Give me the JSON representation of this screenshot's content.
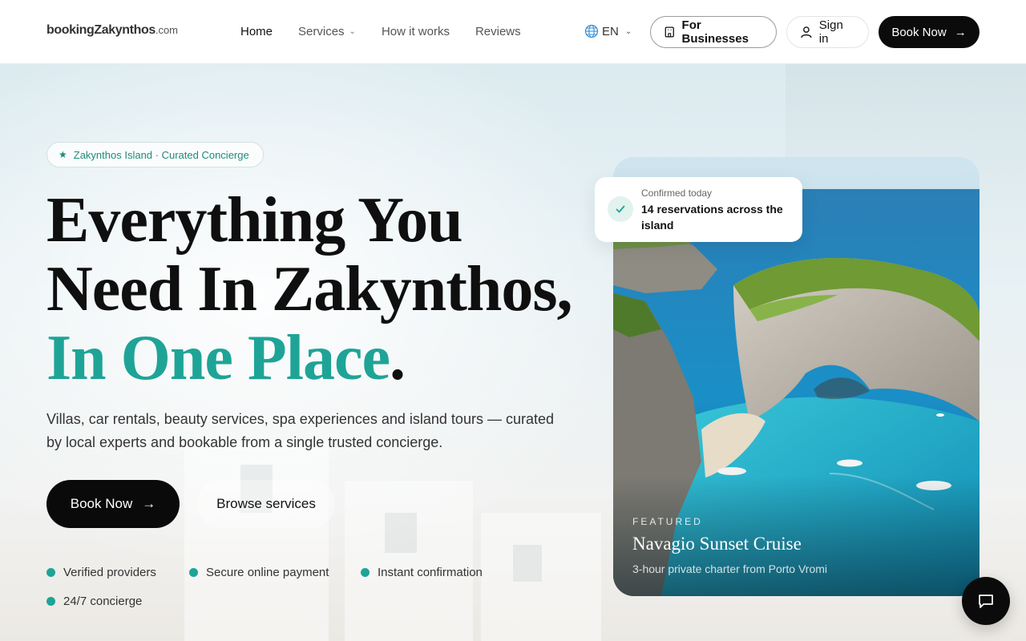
{
  "brand": {
    "name": "bookingZakynthos",
    "tld": ".com"
  },
  "nav": {
    "items": [
      {
        "label": "Home",
        "active": true
      },
      {
        "label": "Services",
        "has_dropdown": true
      },
      {
        "label": "How it works"
      },
      {
        "label": "Reviews"
      }
    ]
  },
  "header": {
    "language": "EN",
    "businesses_label": "For Businesses",
    "signin_label": "Sign in",
    "book_label": "Book Now"
  },
  "hero": {
    "badge": "Zakynthos Island · Curated Concierge",
    "headline_part1": "Everything You Need In Zakynthos,",
    "headline_accent": "In One Place",
    "headline_end": ".",
    "subtext": "Villas, car rentals, beauty services, spa experiences and island tours — curated by local experts and bookable from a single trusted concierge.",
    "primary_cta": "Book Now",
    "secondary_cta": "Browse services",
    "features": [
      "Verified providers",
      "Secure online payment",
      "Instant confirmation",
      "24/7 concierge"
    ]
  },
  "card": {
    "eyebrow": "FEATURED",
    "title": "Navagio Sunset Cruise",
    "subtitle": "3-hour private charter from Porto Vromi"
  },
  "confirmation": {
    "label": "Confirmed today",
    "value": "14 reservations across the island"
  },
  "colors": {
    "accent": "#1ea497",
    "primary_button": "#0b0b0b",
    "sea": "#1a8fc7"
  },
  "icons": {
    "globe": "globe-icon",
    "building": "building-icon",
    "user": "user-icon",
    "arrow": "arrow-right-icon",
    "check": "check-icon",
    "chat": "chat-bubble-icon",
    "star": "star-icon"
  }
}
